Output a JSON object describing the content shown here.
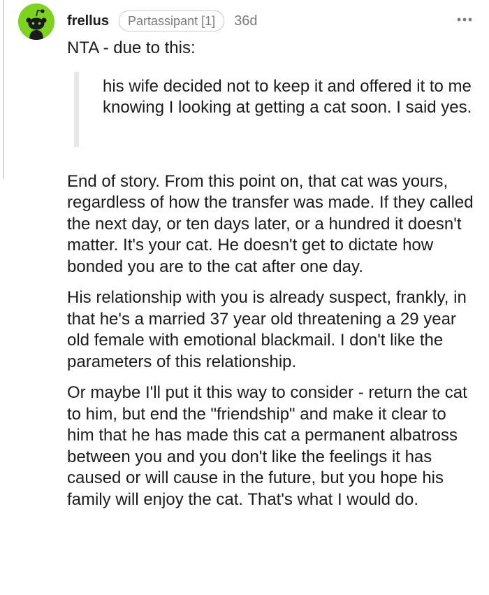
{
  "comment": {
    "username": "frellus",
    "flair": "Partassipant [1]",
    "age": "36d",
    "more_icon": "more-options-icon",
    "avatar_icon": "reddit-snoo-avatar-icon",
    "colors": {
      "avatar_bg": "#7ed321",
      "quote_bar": "#e7e7e7",
      "meta_text": "#7a7a7a"
    },
    "intro": "NTA - due to this:",
    "quote": "his wife decided not to keep it and offered it to me knowing I looking at getting a cat soon. I said yes.",
    "paragraphs": [
      "End of story. From this point on, that cat was yours, regardless of how the transfer was made. If they called the next day, or ten days later, or a hundred it doesn't matter. It's your cat. He doesn't get to dictate how bonded you are to the cat after one day.",
      "His relationship with you is already suspect, frankly, in that he's a married 37 year old threatening a 29 year old female with emotional blackmail. I don't like the parameters of this relationship.",
      "Or maybe I'll put it this way to consider - return the cat to him, but end the \"friendship\" and make it clear to him that he has made this cat a permanent albatross between you and you don't like the feelings it has caused or will cause in the future, but you hope his family will enjoy the cat. That's what I would do."
    ]
  }
}
